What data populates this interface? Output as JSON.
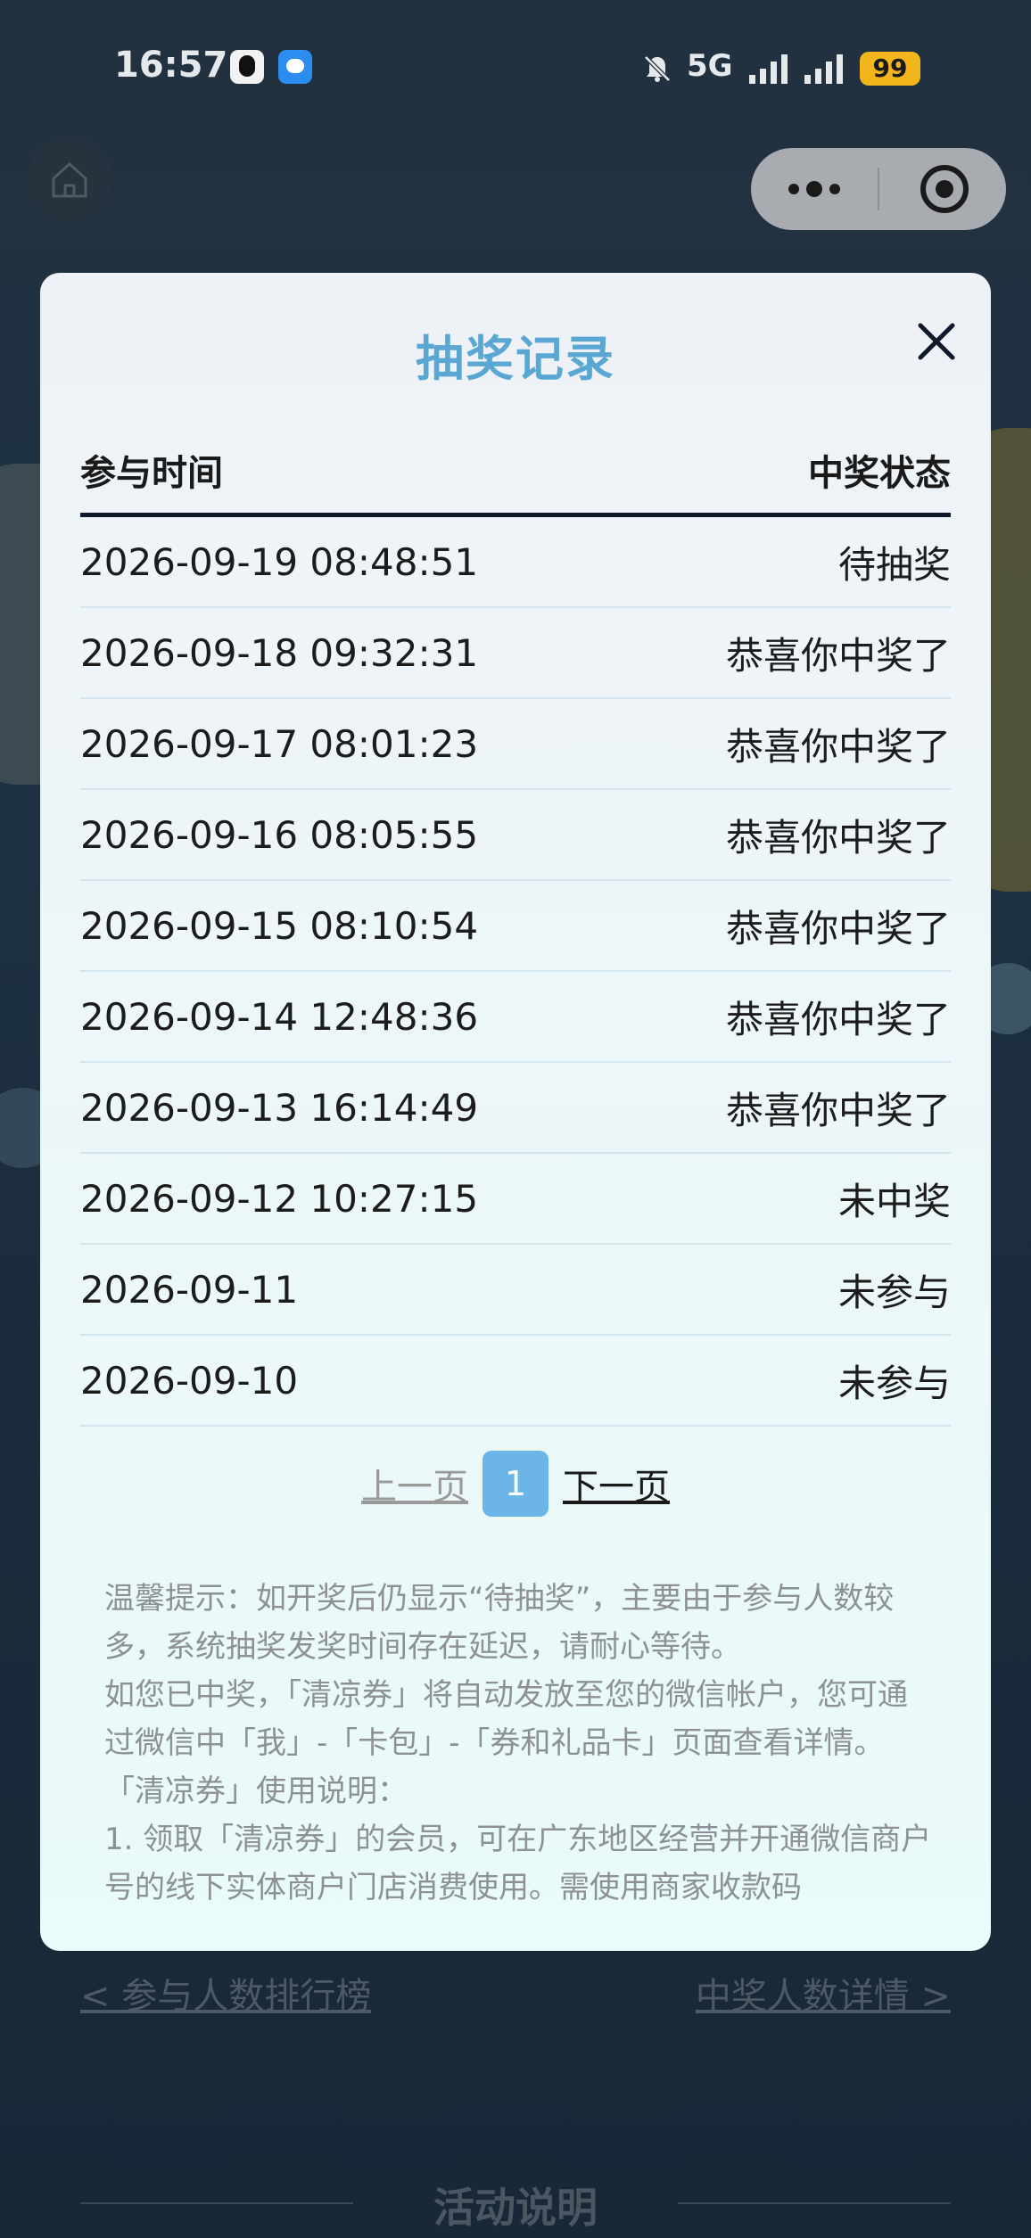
{
  "status_bar": {
    "time": "16:57",
    "network": "5G",
    "battery": "99"
  },
  "modal": {
    "title": "抽奖记录",
    "columns": [
      "参与时间",
      "中奖状态"
    ],
    "rows": [
      {
        "time": "2026-09-19 08:48:51",
        "status": "待抽奖"
      },
      {
        "time": "2026-09-18 09:32:31",
        "status": "恭喜你中奖了"
      },
      {
        "time": "2026-09-17 08:01:23",
        "status": "恭喜你中奖了"
      },
      {
        "time": "2026-09-16 08:05:55",
        "status": "恭喜你中奖了"
      },
      {
        "time": "2026-09-15 08:10:54",
        "status": "恭喜你中奖了"
      },
      {
        "time": "2026-09-14 12:48:36",
        "status": "恭喜你中奖了"
      },
      {
        "time": "2026-09-13 16:14:49",
        "status": "恭喜你中奖了"
      },
      {
        "time": "2026-09-12 10:27:15",
        "status": "未中奖"
      },
      {
        "time": "2026-09-11",
        "status": "未参与"
      },
      {
        "time": "2026-09-10",
        "status": "未参与"
      }
    ],
    "pagination": {
      "prev": "上一页",
      "current": "1",
      "next": "下一页"
    },
    "notes": [
      "温馨提示：如开奖后仍显示“待抽奖”，主要由于参与人数较多，系统抽奖发奖时间存在延迟，请耐心等待。",
      "如您已中奖，「清凉券」将自动发放至您的微信帐户，您可通过微信中「我」-「卡包」-「券和礼品卡」页面查看详情。",
      "「清凉券」使用说明：",
      "1. 领取「清凉券」的会员，可在广东地区经营并开通微信商户号的线下实体商户门店消费使用。需使用商家收款码"
    ]
  },
  "background": {
    "link_left": "< 参与人数排行榜",
    "link_right": "中奖人数详情 >",
    "section_title": "活动说明"
  },
  "icons": {
    "home": "home-icon",
    "more": "more-dots-icon",
    "close_program": "target-close-icon",
    "modal_close": "close-icon",
    "mute": "bell-muted-icon",
    "signal": "signal-icon"
  }
}
